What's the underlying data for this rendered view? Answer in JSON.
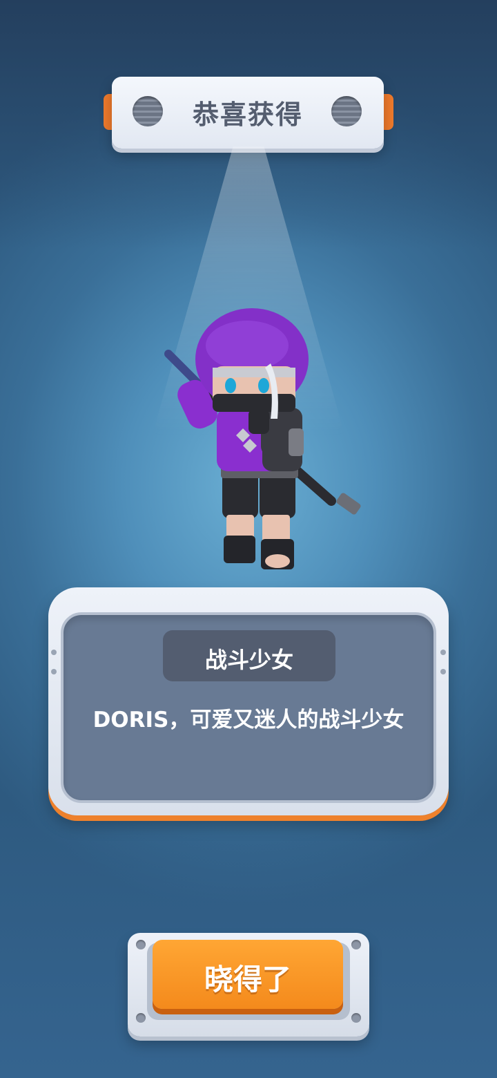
{
  "banner": {
    "title": "恭喜获得"
  },
  "reward": {
    "character_name": "战斗少女",
    "description": "DORIS，可爱又迷人的战斗少女",
    "character_image": "ninja-girl-character"
  },
  "actions": {
    "confirm_label": "晓得了"
  },
  "colors": {
    "accent_orange": "#f48a1c",
    "panel_slate": "#687a94",
    "banner_text": "#545d6f",
    "background_blue": "#4f8fba"
  }
}
